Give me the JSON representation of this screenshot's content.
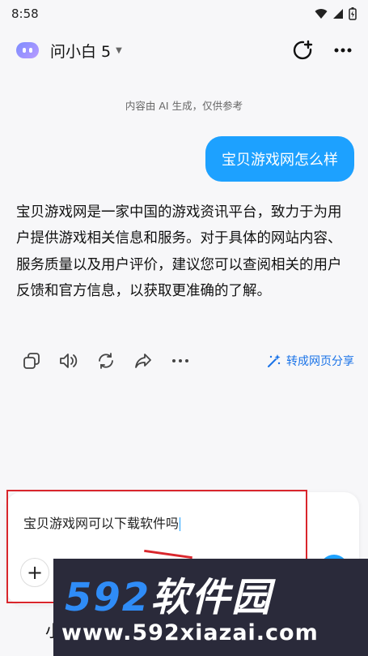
{
  "status_bar": {
    "time": "8:58"
  },
  "header": {
    "assistant_name": "问小白 5"
  },
  "chat": {
    "disclaimer": "内容由 AI 生成，仅供参考",
    "user_message": "宝贝游戏网怎么样",
    "answer": "宝贝游戏网是一家中国的游戏资讯平台，致力于为用户提供游戏相关信息和服务。对于具体的网站内容、服务质量以及用户评价，建议您可以查阅相关的用户反馈和官方信息，以获取更准确的了解。",
    "to_webpage_label": "转成网页分享"
  },
  "input": {
    "value": "宝贝游戏网可以下载软件吗",
    "plus_label": "+"
  },
  "bottom": {
    "partial_label": "小"
  },
  "watermark": {
    "main_digits": "592",
    "main_cn": "软件园",
    "url": "www.592xiazai.com"
  },
  "colors": {
    "accent": "#1da1ff",
    "highlight": "#d9262c",
    "link": "#1a73e8"
  }
}
